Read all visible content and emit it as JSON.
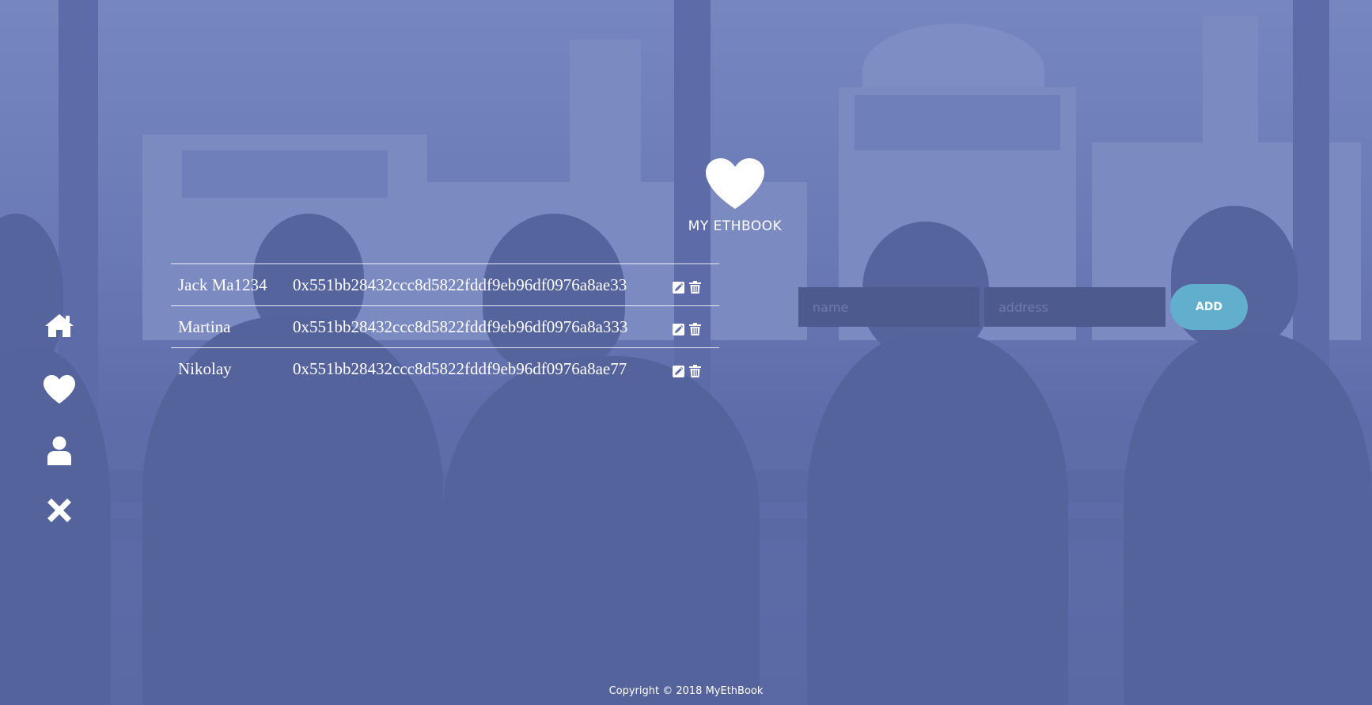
{
  "brand": {
    "title": "MY ETHBOOK",
    "logo_icon": "heart-icon"
  },
  "sidebar": {
    "items": [
      {
        "name": "home",
        "icon": "home-icon"
      },
      {
        "name": "favorites",
        "icon": "heart-icon"
      },
      {
        "name": "profile",
        "icon": "user-icon"
      },
      {
        "name": "close",
        "icon": "close-icon"
      }
    ]
  },
  "contacts": [
    {
      "name": "Jack Ma1234",
      "address": "0x551bb28432ccc8d5822fddf9eb96df0976a8ae33"
    },
    {
      "name": "Martina",
      "address": "0x551bb28432ccc8d5822fddf9eb96df0976a8a333"
    },
    {
      "name": "Nikolay",
      "address": "0x551bb28432ccc8d5822fddf9eb96df0976a8ae77"
    }
  ],
  "row_actions": {
    "edit_icon": "pencil-icon",
    "delete_icon": "trash-icon"
  },
  "form": {
    "name_placeholder": "name",
    "name_value": "",
    "address_placeholder": "address",
    "address_value": "",
    "add_label": "ADD"
  },
  "footer": {
    "copyright": "Copyright © 2018 MyEthBook"
  },
  "colors": {
    "overlay": "#5c6ba6",
    "input_bg": "#4d5a8e",
    "accent_button": "#62aecd",
    "text": "#ffffff"
  }
}
